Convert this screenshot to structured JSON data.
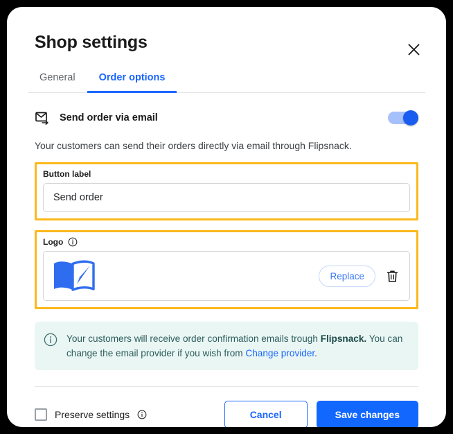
{
  "dialog": {
    "title": "Shop settings",
    "close_icon": "close-icon"
  },
  "tabs": [
    {
      "label": "General",
      "active": false
    },
    {
      "label": "Order options",
      "active": true
    }
  ],
  "email_section": {
    "icon": "send-email-icon",
    "title": "Send order via email",
    "toggle_state": "on",
    "description": "Your customers can send their orders directly via email through Flipsnack."
  },
  "button_label_field": {
    "label": "Button label",
    "value": "Send order",
    "placeholder": "Send order",
    "highlighted": true,
    "highlight_color": "#fcb81c"
  },
  "logo_field": {
    "label": "Logo",
    "info_icon": "info-icon",
    "logo_alt": "flipsnack-logo",
    "replace_label": "Replace",
    "delete_icon": "trash-icon",
    "highlighted": true,
    "highlight_color": "#fcb81c"
  },
  "banner": {
    "icon": "info-icon",
    "text_before": "Your customers will receive order confirmation emails trough ",
    "brand": "Flipsnack.",
    "text_middle": " You can change the email provider if you wish from ",
    "link": "Change provider",
    "text_after": ".",
    "background": "#e9f6f4"
  },
  "footer": {
    "preserve_label": "Preserve settings",
    "preserve_info_icon": "info-icon",
    "preserve_checked": false,
    "cancel_label": "Cancel",
    "save_label": "Save changes",
    "accent_color": "#1267ff"
  }
}
